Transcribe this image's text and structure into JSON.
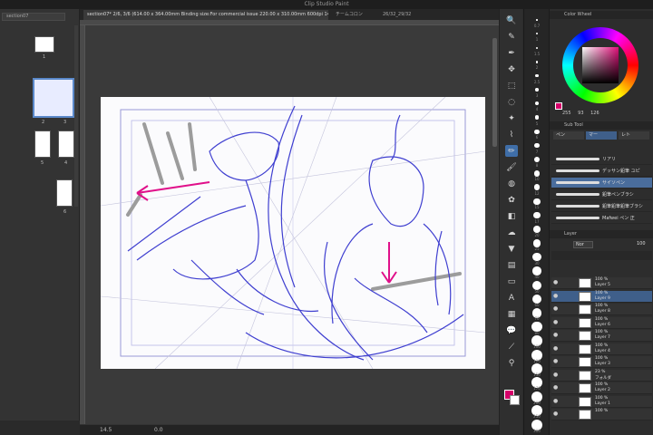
{
  "app": {
    "title": "Clip Studio Paint"
  },
  "left_panel": {
    "tab_label": "section07",
    "pages": [
      {
        "label": "1"
      },
      {
        "label": "2"
      },
      {
        "label": "3"
      },
      {
        "label": "5"
      },
      {
        "label": "4"
      },
      {
        "label": "6"
      }
    ]
  },
  "tabs": [
    {
      "label": "section07* 2/6, 3/6 (614.00 x 364.00mm Binding size:For commercial issue 220.00 x 310.00mm 600dpi 14.5%)"
    },
    {
      "label": "チームコロン"
    },
    {
      "label": "26/32_29/32"
    }
  ],
  "status": {
    "zoom": "14.5",
    "angle": "0.0"
  },
  "tools": [
    {
      "icon": "zoom-icon",
      "glyph": "🔍"
    },
    {
      "icon": "eyedropper-icon",
      "glyph": "✎"
    },
    {
      "icon": "pen-icon",
      "glyph": "✒"
    },
    {
      "icon": "move-icon",
      "glyph": "✥"
    },
    {
      "icon": "selection-icon",
      "glyph": "⬚"
    },
    {
      "icon": "lasso-icon",
      "glyph": "◌"
    },
    {
      "icon": "wand-icon",
      "glyph": "✦"
    },
    {
      "icon": "eyedropper2-icon",
      "glyph": "⌇"
    },
    {
      "icon": "pencil-icon",
      "glyph": "✏",
      "active": true
    },
    {
      "icon": "brush-icon",
      "glyph": "🖌"
    },
    {
      "icon": "airbrush-icon",
      "glyph": "◍"
    },
    {
      "icon": "decoration-icon",
      "glyph": "✿"
    },
    {
      "icon": "eraser-icon",
      "glyph": "◧"
    },
    {
      "icon": "blend-icon",
      "glyph": "☁"
    },
    {
      "icon": "fill-icon",
      "glyph": "▼"
    },
    {
      "icon": "gradient-icon",
      "glyph": "▤"
    },
    {
      "icon": "figure-icon",
      "glyph": "▭"
    },
    {
      "icon": "text-icon",
      "glyph": "A"
    },
    {
      "icon": "frame-icon",
      "glyph": "▦"
    },
    {
      "icon": "balloon-icon",
      "glyph": "💬"
    },
    {
      "icon": "line-icon",
      "glyph": "⟋"
    },
    {
      "icon": "correct-icon",
      "glyph": "⚲"
    }
  ],
  "sizes": [
    "0.7",
    "1",
    "1.5",
    "2",
    "2.5",
    "3",
    "4",
    "5",
    "6",
    "7",
    "8",
    "10",
    "12",
    "15",
    "17",
    "20",
    "25",
    "30",
    "40",
    "50",
    "60",
    "70",
    "80",
    "100",
    "120",
    "150",
    "170",
    "200",
    "250",
    "300"
  ],
  "color_panel": {
    "title": "Color Wheel",
    "h": "255",
    "s": "93",
    "v": "126",
    "accent": "#d6006a"
  },
  "subtool": {
    "title": "Sub Tool",
    "tabs": [
      "ペン",
      "マー",
      "レト"
    ],
    "brushes": [
      {
        "name": "リアリ"
      },
      {
        "name": "デッサン鉛筆 ユピ"
      },
      {
        "name": "サイソペン"
      },
      {
        "name": "鉛筆ペンブラシ"
      },
      {
        "name": "鉛筆鉛筆鉛筆ブラシ"
      },
      {
        "name": "Mafwei ペン 正"
      }
    ]
  },
  "layer_panel": {
    "title": "Layer",
    "blend": "Nor",
    "opacity": "100",
    "layers": [
      {
        "opacity": "100 %",
        "name": "Layer 5"
      },
      {
        "opacity": "100 %",
        "name": "Layer 9"
      },
      {
        "opacity": "100 %",
        "name": "Layer 8"
      },
      {
        "opacity": "100 %",
        "name": "Layer 6"
      },
      {
        "opacity": "100 %",
        "name": "Layer 7"
      },
      {
        "opacity": "100 %",
        "name": "Layer 4"
      },
      {
        "opacity": "100 %",
        "name": "Layer 3"
      },
      {
        "opacity": "23 %",
        "name": "フォルダ"
      },
      {
        "opacity": "100 %",
        "name": "Layer 2"
      },
      {
        "opacity": "100 %",
        "name": "Layer 1"
      },
      {
        "opacity": "100 %",
        "name": ""
      }
    ]
  }
}
